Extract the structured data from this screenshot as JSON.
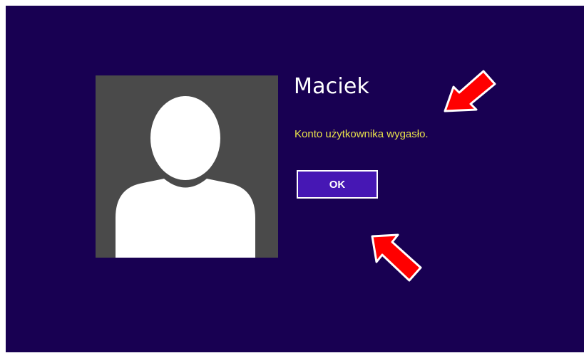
{
  "lock_screen": {
    "user_name": "Maciek",
    "error_message": "Konto użytkownika wygasło.",
    "ok_label": "OK"
  },
  "icons": {
    "avatar": "default-user-silhouette-icon",
    "annotation_arrows": "red-arrow-icon"
  },
  "colors": {
    "background": "#180052",
    "avatar_tile": "#4a4a4a",
    "message_text": "#e8e04a",
    "button_fill": "#4617b4",
    "annotation_arrow": "#ff0000"
  }
}
